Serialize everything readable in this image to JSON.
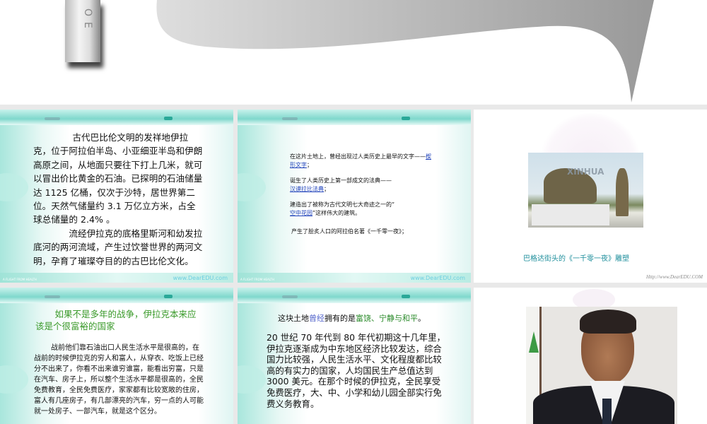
{
  "top_slide": {
    "tube_letters": "OE"
  },
  "slide1": {
    "paragraphs": [
      "古代巴比伦文明的发祥地伊拉克，位于阿拉伯半岛、小亚细亚半岛和伊朗高原之间，从地面只要往下打上几米，就可以冒出价比黄金的石油。已探明的石油储量达 1125 亿桶，仅次于沙特，居世界第二位。天然气储量约 3.1 万亿立方米，占全球总储量的 2.4% 。",
      "流经伊拉克的底格里斯河和幼发拉底河的两河流域，产生过饮誉世界的两河文明，孕育了璀璨夺目的的古巴比伦文化。"
    ],
    "footer_brand": "A FLIGHT FROM HEALTH",
    "footer_url": "www.DearEDU.com"
  },
  "slide2": {
    "line1_text": "在这片土地上，曾经出现过人类历史上最早的文字——",
    "line1_link": "楔形文字",
    "line1_end": "；",
    "line2_text": "诞生了人类历史上第一部成文的法典——",
    "line2_link": "汉谟拉比法典",
    "line2_end": "；",
    "line3_text": "建造出了被称为古代文明七大奇迹之一的“",
    "line3_link": "空中花园",
    "line3_end": "”这样伟大的建筑。",
    "line4_text": "产生了脍炙人口的阿拉伯名著《一千零一夜》；",
    "footer_brand": "A FLIGHT FROM HEALTH",
    "footer_url": "www.DearEDU.com"
  },
  "slide3": {
    "image_watermark": "XINHUA",
    "caption": "巴格达街头的《一千零一夜》雕塑",
    "footer_url": "Http://www.DearEDU.COM"
  },
  "slide4": {
    "heading": "如果不是多年的战争，伊拉克本来应该是个很富裕的国家",
    "body": "战前他们靠石油出口人民生活水平是很高的，在战前的时候伊拉克的穷人和富人，从穿衣、吃饭上已经分不出来了，你看不出来谁穷谁富，能看出穷富，只是在汽车、房子上，所以整个生活水平都是很高的，全民免费教育，全民免费医疗，家家都有比较宽敞的住房，富人有几座房子，有几部漂亮的汽车，穷一点的人可能就一处房子、一部汽车，就是这个区分。"
  },
  "slide5": {
    "heading_a": "这块土地",
    "heading_b": "曾经",
    "heading_c": "拥有的是",
    "heading_d": "富饶、宁静与和平",
    "heading_e": "。",
    "body": "20 世纪 70 年代到 80 年代初期这十几年里，伊拉克逐渐成为中东地区经济比较发达，综合国力比较强，人民生活水平、文化程度都比较高的有实力的国家，人均国民生产总值达到 3000 美元。在那个时候的伊拉克，全民享受免费医疗，大、中、小学和幼儿园全部实行免费义务教育。"
  },
  "colors": {
    "teal_caption": "#1f8f9c",
    "green_heading": "#3a9a2a",
    "link": "#2244bb"
  }
}
